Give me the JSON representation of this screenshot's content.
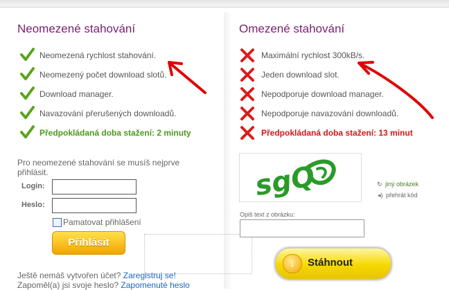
{
  "left": {
    "heading": "Neomezené stahování",
    "features": [
      "Neomezená rychlost stahování.",
      "Neomezený počet download slotů.",
      "Download manager.",
      "Navazování přerušených downloadů.",
      "Předpokládaná doba stažení: 2 minuty"
    ],
    "login_prompt_line1": "Pro neomezené stahování se musíš nejprve",
    "login_prompt_line2": "přihlásit.",
    "login_label": "Login:",
    "password_label": "Heslo:",
    "login_value": "",
    "password_value": "",
    "remember_label": "Pamatovat přihlášení",
    "login_button": "Přihlásit",
    "no_account_text": "Ještě nemáš vytvořen účet?",
    "register_link": "Zaregistruj se!",
    "forgot_text": "Zapoměl(a) jsi svoje heslo?",
    "forgot_link": "Zapomenuté heslo"
  },
  "right": {
    "heading": "Omezené stahování",
    "features": [
      "Maximální rychlost 300kB/s.",
      "Jeden download slot.",
      "Nepodporuje download manager.",
      "Nepodporuje navazování downloadů.",
      "Předpokládaná doba stažení: 13 minut"
    ],
    "captcha_text": "sgQ",
    "new_image_link": "jiný obrázek",
    "play_code_link": "přehrát kód",
    "captcha_label": "Opiš text z obrázku:",
    "captcha_value": "",
    "download_button": "Stáhnout"
  },
  "colors": {
    "heading": "#7a1e6e",
    "check": "#5aa41c",
    "cross": "#d81c1c",
    "link": "#1a66bd",
    "button_yellow": "#f5d800",
    "arrow": "#e00000"
  },
  "icons": {
    "check": "check-icon",
    "cross": "cross-icon",
    "refresh": "refresh-icon",
    "speaker": "speaker-icon",
    "download": "download-arrow-icon"
  }
}
